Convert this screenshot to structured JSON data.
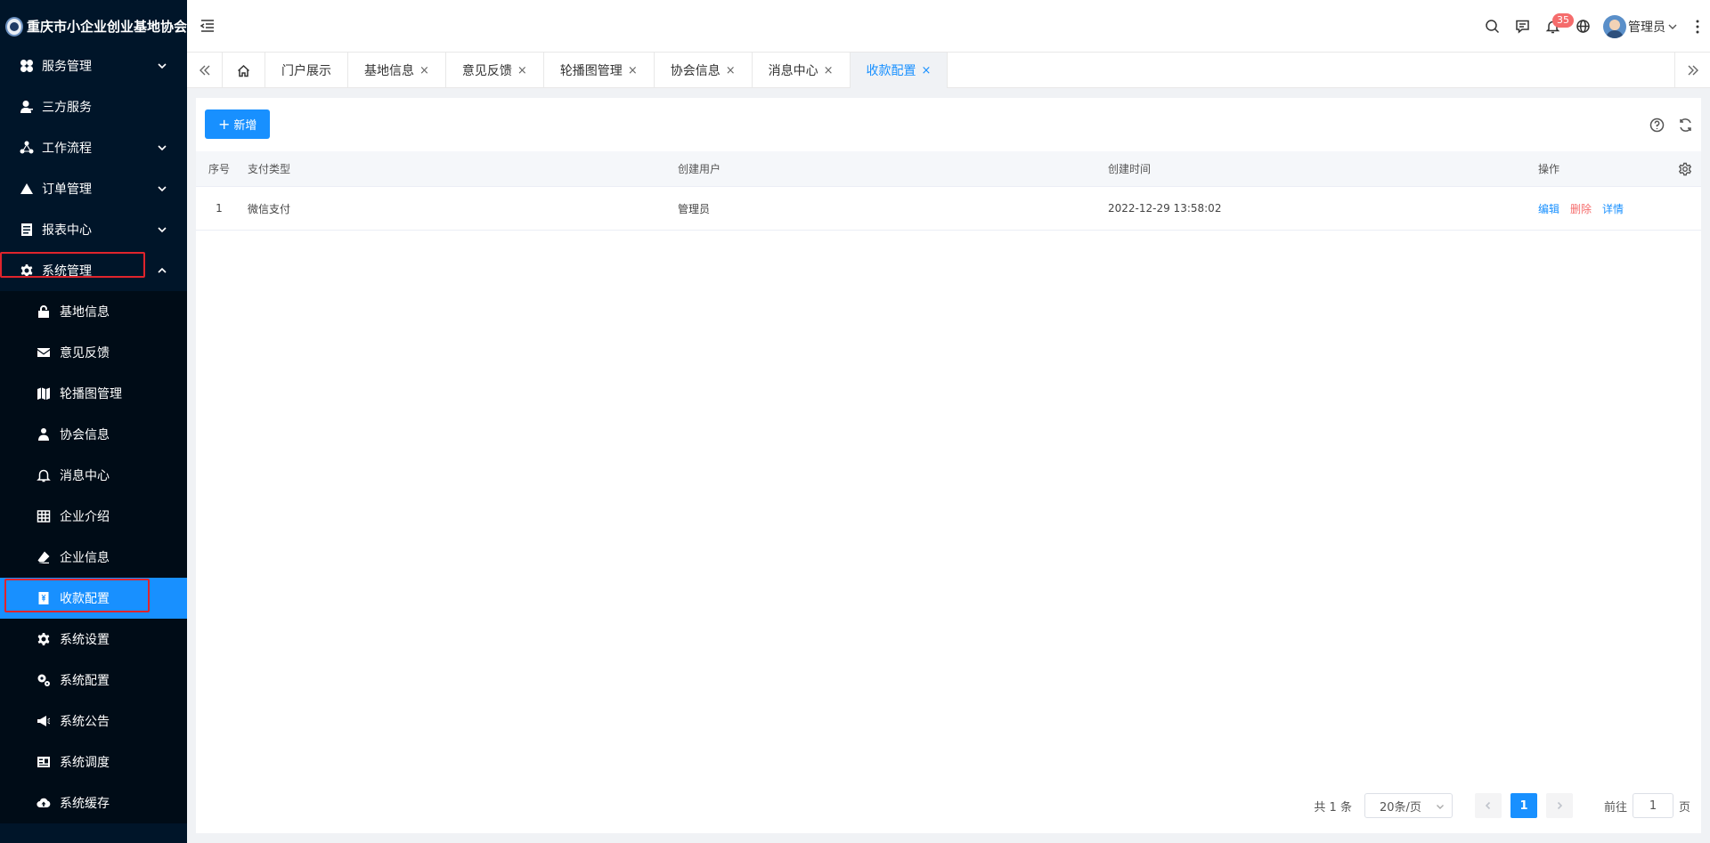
{
  "app": {
    "logo_text": "重庆市小企业创业基地协会"
  },
  "sidebar": {
    "items": [
      {
        "label": "服务管理",
        "icon": "grid-clover-icon",
        "expandable": true,
        "chevron": "down"
      },
      {
        "label": "三方服务",
        "icon": "user-icon",
        "expandable": false
      },
      {
        "label": "工作流程",
        "icon": "nodes-icon",
        "expandable": true,
        "chevron": "down"
      },
      {
        "label": "订单管理",
        "icon": "triangle-icon",
        "expandable": true,
        "chevron": "down"
      },
      {
        "label": "报表中心",
        "icon": "report-icon",
        "expandable": true,
        "chevron": "down"
      },
      {
        "label": "系统管理",
        "icon": "gear-icon",
        "expandable": true,
        "chevron": "up"
      }
    ],
    "sub_items": [
      {
        "label": "基地信息",
        "icon": "lock-icon"
      },
      {
        "label": "意见反馈",
        "icon": "mail-icon"
      },
      {
        "label": "轮播图管理",
        "icon": "map-icon"
      },
      {
        "label": "协会信息",
        "icon": "users-icon"
      },
      {
        "label": "消息中心",
        "icon": "bell-icon"
      },
      {
        "label": "企业介绍",
        "icon": "table-icon"
      },
      {
        "label": "企业信息",
        "icon": "eraser-icon"
      },
      {
        "label": "收款配置",
        "icon": "receipt-icon",
        "active": true
      },
      {
        "label": "系统设置",
        "icon": "gear-icon"
      },
      {
        "label": "系统配置",
        "icon": "gears-icon"
      },
      {
        "label": "系统公告",
        "icon": "megaphone-icon"
      },
      {
        "label": "系统调度",
        "icon": "schedule-icon"
      },
      {
        "label": "系统缓存",
        "icon": "cloud-icon"
      }
    ]
  },
  "header": {
    "notification_count": "35",
    "user_name": "管理员"
  },
  "tabs": [
    {
      "label": "门户展示",
      "closable": false
    },
    {
      "label": "基地信息",
      "closable": true
    },
    {
      "label": "意见反馈",
      "closable": true
    },
    {
      "label": "轮播图管理",
      "closable": true
    },
    {
      "label": "协会信息",
      "closable": true
    },
    {
      "label": "消息中心",
      "closable": true
    },
    {
      "label": "收款配置",
      "closable": true,
      "active": true
    }
  ],
  "tab_close_glyph": "×",
  "toolbar": {
    "add_label": "新增"
  },
  "table": {
    "columns": [
      "序号",
      "支付类型",
      "创建用户",
      "创建时间",
      "操作"
    ],
    "rows": [
      {
        "index": "1",
        "pay_type": "微信支付",
        "creator": "管理员",
        "created_at": "2022-12-29 13:58:02"
      }
    ],
    "actions": {
      "edit": "编辑",
      "delete": "删除",
      "detail": "详情"
    }
  },
  "pagination": {
    "total_text": "共 1 条",
    "page_size": "20条/页",
    "current_page": "1",
    "goto_prefix": "前往",
    "goto_value": "1",
    "goto_suffix": "页"
  },
  "colors": {
    "sidebar_bg": "#001529",
    "submenu_bg": "#000c17",
    "accent": "#1890ff",
    "danger": "#f56c6c",
    "highlight_box": "#e0242c"
  }
}
